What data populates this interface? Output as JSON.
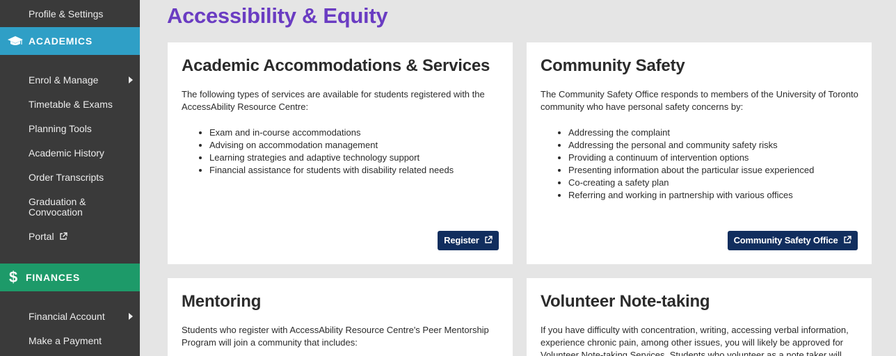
{
  "sidebar": {
    "profile_settings": "Profile & Settings",
    "academics": {
      "title": "ACADEMICS",
      "items": [
        "Enrol & Manage",
        "Timetable & Exams",
        "Planning Tools",
        "Academic History",
        "Order Transcripts",
        "Graduation &",
        "Convocation",
        "Portal"
      ]
    },
    "finances": {
      "title": "FINANCES",
      "items": [
        "Financial Account",
        "Make a Payment"
      ]
    }
  },
  "main": {
    "title": "Accessibility & Equity",
    "cards": [
      {
        "title": "Academic Accommodations & Services",
        "text": "The following types of services are available for students registered with the AccessAbility Resource Centre:",
        "bullets": [
          "Exam and in-course accommodations",
          "Advising on accommodation management",
          "Learning strategies and adaptive technology support",
          "Financial assistance for students with disability related needs"
        ],
        "button": "Register"
      },
      {
        "title": "Community Safety",
        "text": "The Community Safety Office responds to members of the University of Toronto community who have personal safety concerns by:",
        "bullets": [
          "Addressing the complaint",
          "Addressing the personal and community safety risks",
          "Providing a continuum of intervention options",
          "Presenting information about the particular issue experienced",
          "Co-creating a safety plan",
          "Referring and working in partnership with various offices"
        ],
        "button": "Community Safety Office"
      },
      {
        "title": "Mentoring",
        "text": "Students who register with AccessAbility Resource Centre's Peer Mentorship Program will join a community that includes:"
      },
      {
        "title": "Volunteer Note-taking",
        "text": "If you have difficulty with concentration, writing, accessing verbal information, experience chronic pain, among other issues, you will likely be approved for Volunteer Note-taking Services. Students who volunteer as a note taker will"
      }
    ]
  },
  "colors": {
    "sidebar_bg": "#3a3a3a",
    "academics_bg": "#2f9fc6",
    "finances_bg": "#1d9a69",
    "title_purple": "#6a3cc2",
    "button_navy": "#112e5e"
  },
  "icons": {
    "academics": "graduation-cap-icon",
    "finances": "dollar-icon",
    "external": "external-link-icon"
  }
}
